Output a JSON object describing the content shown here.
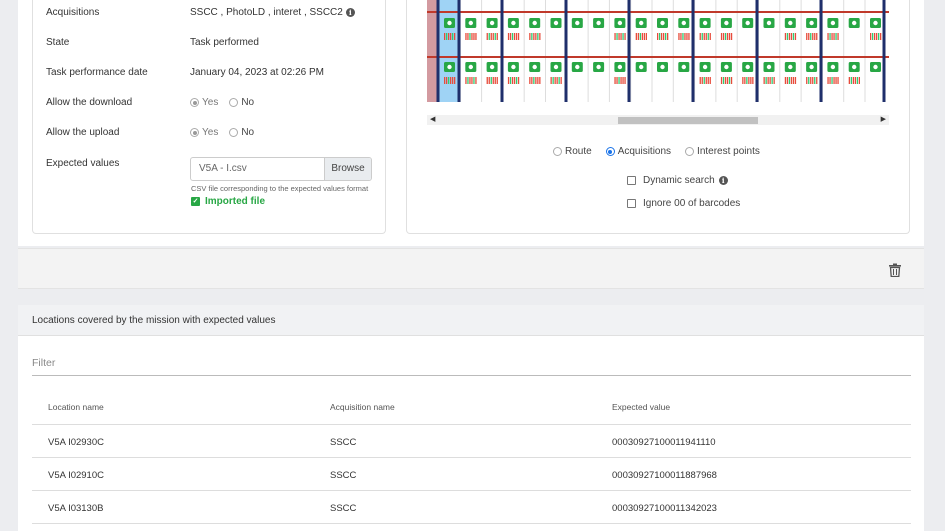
{
  "details": {
    "rows": [
      {
        "label": "Acquisitions",
        "value": "SSCC , PhotoLD , interet , SSCC2"
      },
      {
        "label": "State",
        "value": "Task performed"
      },
      {
        "label": "Task performance date",
        "value": "January 04, 2023 at 02:26 PM"
      },
      {
        "label": "Allow the download",
        "yes": "Yes",
        "no": "No"
      },
      {
        "label": "Allow the upload",
        "yes": "Yes",
        "no": "No"
      },
      {
        "label": "Expected values"
      }
    ],
    "file_name": "V5A - I.csv",
    "browse_label": "Browse",
    "help_text": "CSV file corresponding to the expected values format",
    "imported_label": "Imported file"
  },
  "map": {
    "view_options": [
      "Route",
      "Acquisitions",
      "Interest points"
    ],
    "selected_view": "Acquisitions",
    "dynamic_search_label": "Dynamic search",
    "ignore_label": "Ignore 00 of barcodes",
    "scroll_position": 0.6
  },
  "locations": {
    "title": "Locations covered by the mission with expected values",
    "filter_placeholder": "Filter",
    "columns": [
      "Location name",
      "Acquisition name",
      "Expected value"
    ],
    "rows": [
      [
        "V5A I02930C",
        "SSCC",
        "00030927100011941110"
      ],
      [
        "V5A I02910C",
        "SSCC",
        "00030927100011887968"
      ],
      [
        "V5A I03130B",
        "SSCC",
        "00030927100011342023"
      ]
    ]
  },
  "colors": {
    "accent_green": "#28a745",
    "shelf_blue": "#1f2f6b",
    "beam_red": "#c0392b",
    "selected_blue": "#9fd3f5"
  }
}
